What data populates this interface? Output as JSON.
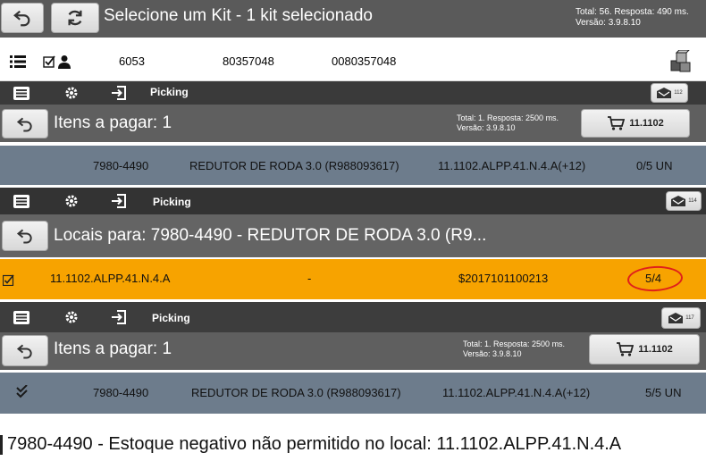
{
  "screen1": {
    "title": "Selecione um Kit - 1 kit selecionado",
    "meta_line1": "Total: 56. Resposta: 490 ms.",
    "meta_line2": "Versão: 3.9.8.10",
    "row": {
      "col1": "6053",
      "col2": "80357048",
      "col3": "0080357048"
    }
  },
  "screen2": {
    "toolbar_label": "Picking",
    "badge": "112",
    "title": "Itens a pagar: 1",
    "meta_line1": "Total: 1. Resposta: 2500 ms.",
    "meta_line2": "Versão: 3.9.8.10",
    "cart_label": "11.1102",
    "row": {
      "code": "7980-4490",
      "desc": "REDUTOR DE RODA 3.0 (R988093617)",
      "loc": "11.1102.ALPP.41.N.4.A(+12)",
      "qty": "0/5 UN"
    }
  },
  "screen3": {
    "toolbar_label": "Picking",
    "badge": "114",
    "title": "Locais para: 7980-4490 - REDUTOR DE RODA 3.0 (R9...",
    "row": {
      "loc": "11.1102.ALPP.41.N.4.A",
      "dash": "-",
      "lot": "$2017101100213",
      "qty": "5/4"
    }
  },
  "screen4": {
    "toolbar_label": "Picking",
    "badge": "117",
    "title": "Itens a pagar: 1",
    "meta_line1": "Total: 1. Resposta: 2500 ms.",
    "meta_line2": "Versão: 3.9.8.10",
    "cart_label": "11.1102",
    "row": {
      "code": "7980-4490",
      "desc": "REDUTOR DE RODA 3.0 (R988093617)",
      "loc": "11.1102.ALPP.41.N.4.A(+12)",
      "qty": "5/5 UN"
    }
  },
  "error_message": "7980-4490 - Estoque negativo não permitido no local: 11.1102.ALPP.41.N.4.A",
  "colors": {
    "orange_row": "#f7a300",
    "blue_gray_row": "#6d7c8c",
    "header_gray": "#5f5f5f",
    "toolbar_dark": "#3a3a3a",
    "annotation_red": "#e0201a"
  },
  "icons": [
    "back-arrow-icon",
    "refresh-icon",
    "list-icon",
    "checkbox-user-icon",
    "packages-icon",
    "menu-icon",
    "gear-icon",
    "exit-icon",
    "mail-icon",
    "cart-icon",
    "checkmark-icon"
  ]
}
